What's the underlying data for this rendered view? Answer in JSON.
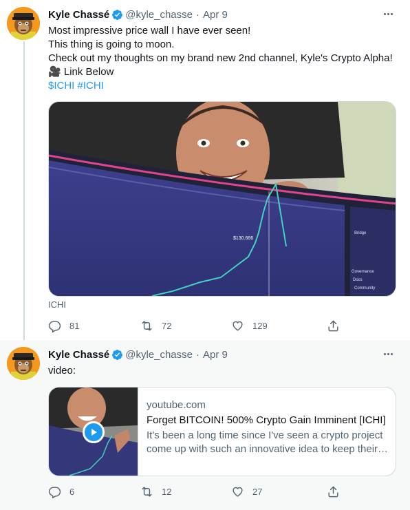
{
  "colors": {
    "accent": "#1d9bf0",
    "muted": "#536471",
    "text": "#0f1419",
    "border": "#cfd9de"
  },
  "tweets": [
    {
      "author": {
        "name": "Kyle Chassé",
        "handle": "@kyle_chasse",
        "verified": true,
        "avatar_icon": "ape-avatar"
      },
      "separator": "·",
      "date": "Apr 9",
      "text_lines": [
        "Most impressive price wall I have ever seen!",
        "This thing is going to moon.",
        "Check out my thoughts on my brand new 2nd channel, Kyle's Crypto Alpha!"
      ],
      "link_line": {
        "emoji": "🎥",
        "text": " Link Below"
      },
      "hashtags": "$ICHI #ICHI",
      "media_caption": "ICHI",
      "media_ui": {
        "price": "$130.666",
        "sidebar_items": [
          "Bridge",
          "Governance",
          "Docs",
          "Community"
        ]
      },
      "actions": {
        "replies": "81",
        "retweets": "72",
        "likes": "129"
      }
    },
    {
      "author": {
        "name": "Kyle Chassé",
        "handle": "@kyle_chasse",
        "verified": true,
        "avatar_icon": "ape-avatar"
      },
      "separator": "·",
      "date": "Apr 9",
      "text": "video:",
      "card": {
        "domain": "youtube.com",
        "title": "Forget BITCOIN! 500% Crypto Gain Imminent [ICHI]",
        "description": "It's been a long time since I've seen a crypto project come up with such an innovative idea to keep their…",
        "icon": "play-icon"
      },
      "actions": {
        "replies": "6",
        "retweets": "12",
        "likes": "27"
      }
    }
  ]
}
